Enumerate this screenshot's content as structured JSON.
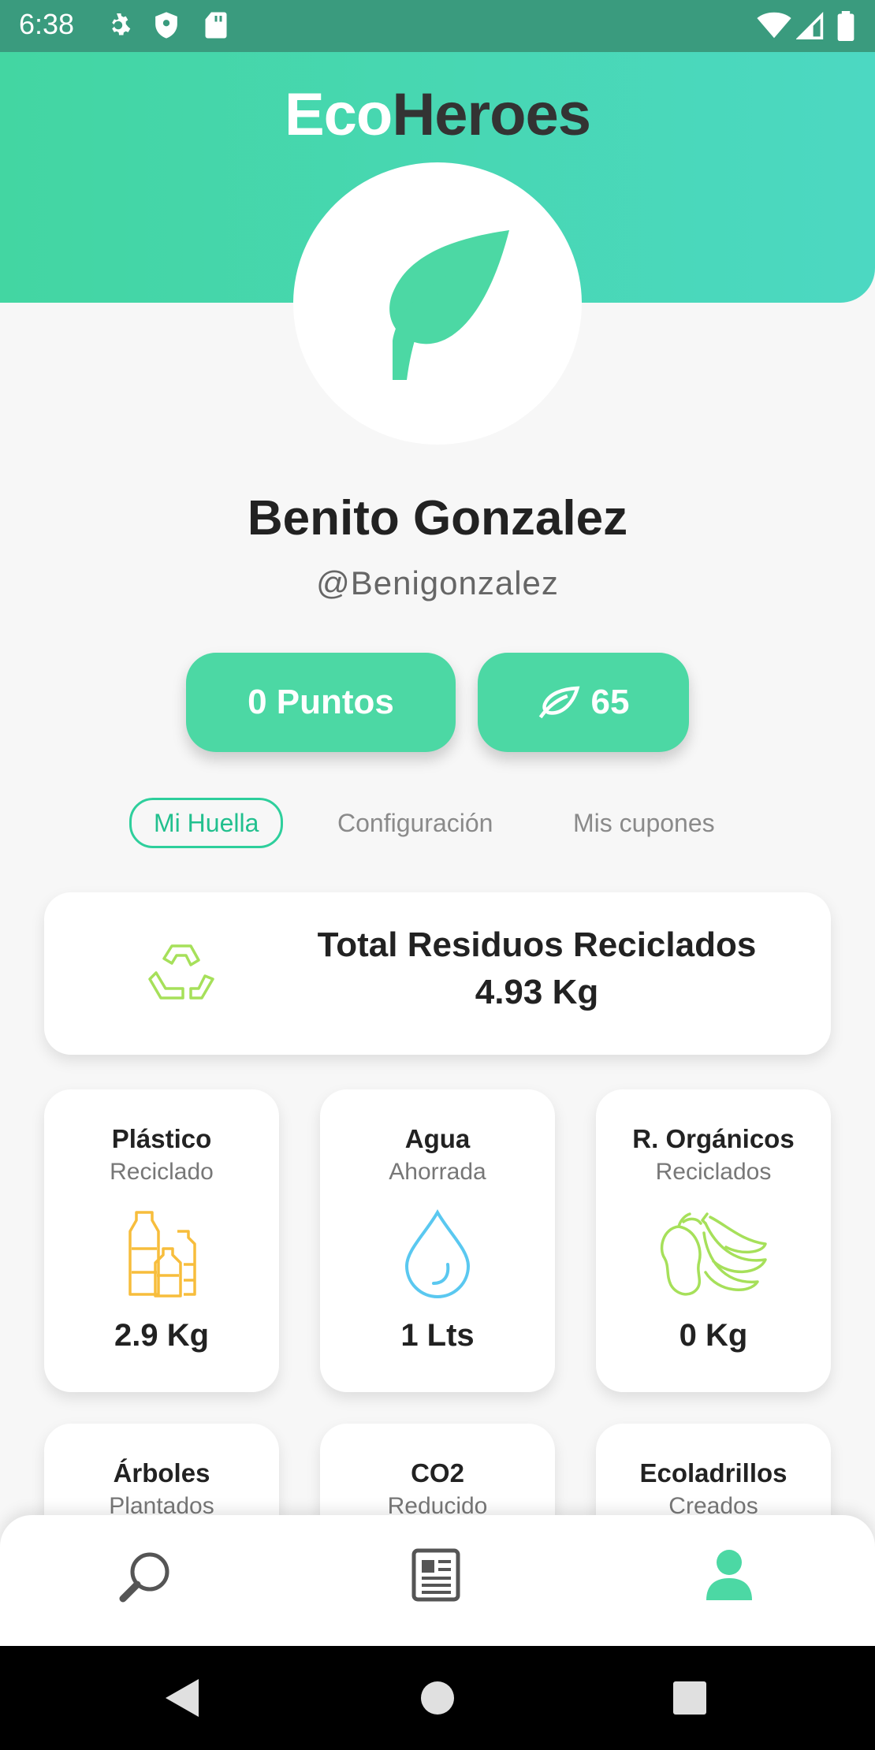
{
  "status_bar": {
    "time": "6:38",
    "icons": [
      "gear-icon",
      "shield-icon",
      "sd-card-icon",
      "wifi-icon",
      "signal-icon",
      "battery-icon"
    ]
  },
  "header": {
    "brand_eco": "Eco",
    "brand_heroes": "Heroes",
    "brand_colors": {
      "eco": "#ffffff",
      "heroes": "#333333"
    },
    "gradient": [
      "#43d6a2",
      "#4cd8c2"
    ]
  },
  "profile": {
    "name": "Benito Gonzalez",
    "handle": "@Benigonzalez"
  },
  "stats": {
    "points_label": "0 Puntos",
    "leaves_value": "65"
  },
  "tabs": [
    {
      "label": "Mi Huella",
      "active": true
    },
    {
      "label": "Configuración",
      "active": false
    },
    {
      "label": "Mis cupones",
      "active": false
    }
  ],
  "total_card": {
    "label": "Total Residuos Reciclados",
    "value": "4.93 Kg"
  },
  "cards": [
    {
      "title": "Plástico",
      "subtitle": "Reciclado",
      "value": "2.9 Kg",
      "icon": "bottles-icon"
    },
    {
      "title": "Agua",
      "subtitle": "Ahorrada",
      "value": "1 Lts",
      "icon": "water-drop-icon"
    },
    {
      "title": "R. Orgánicos",
      "subtitle": "Reciclados",
      "value": "0 Kg",
      "icon": "organic-waste-icon"
    },
    {
      "title": "Árboles",
      "subtitle": "Plantados"
    },
    {
      "title": "CO2",
      "subtitle": "Reducido"
    },
    {
      "title": "Ecoladrillos",
      "subtitle": "Creados"
    }
  ],
  "bottom_nav": [
    {
      "icon": "search-icon",
      "active": false
    },
    {
      "icon": "news-icon",
      "active": false
    },
    {
      "icon": "profile-icon",
      "active": true
    }
  ],
  "accent_color": "#4cd8a4"
}
